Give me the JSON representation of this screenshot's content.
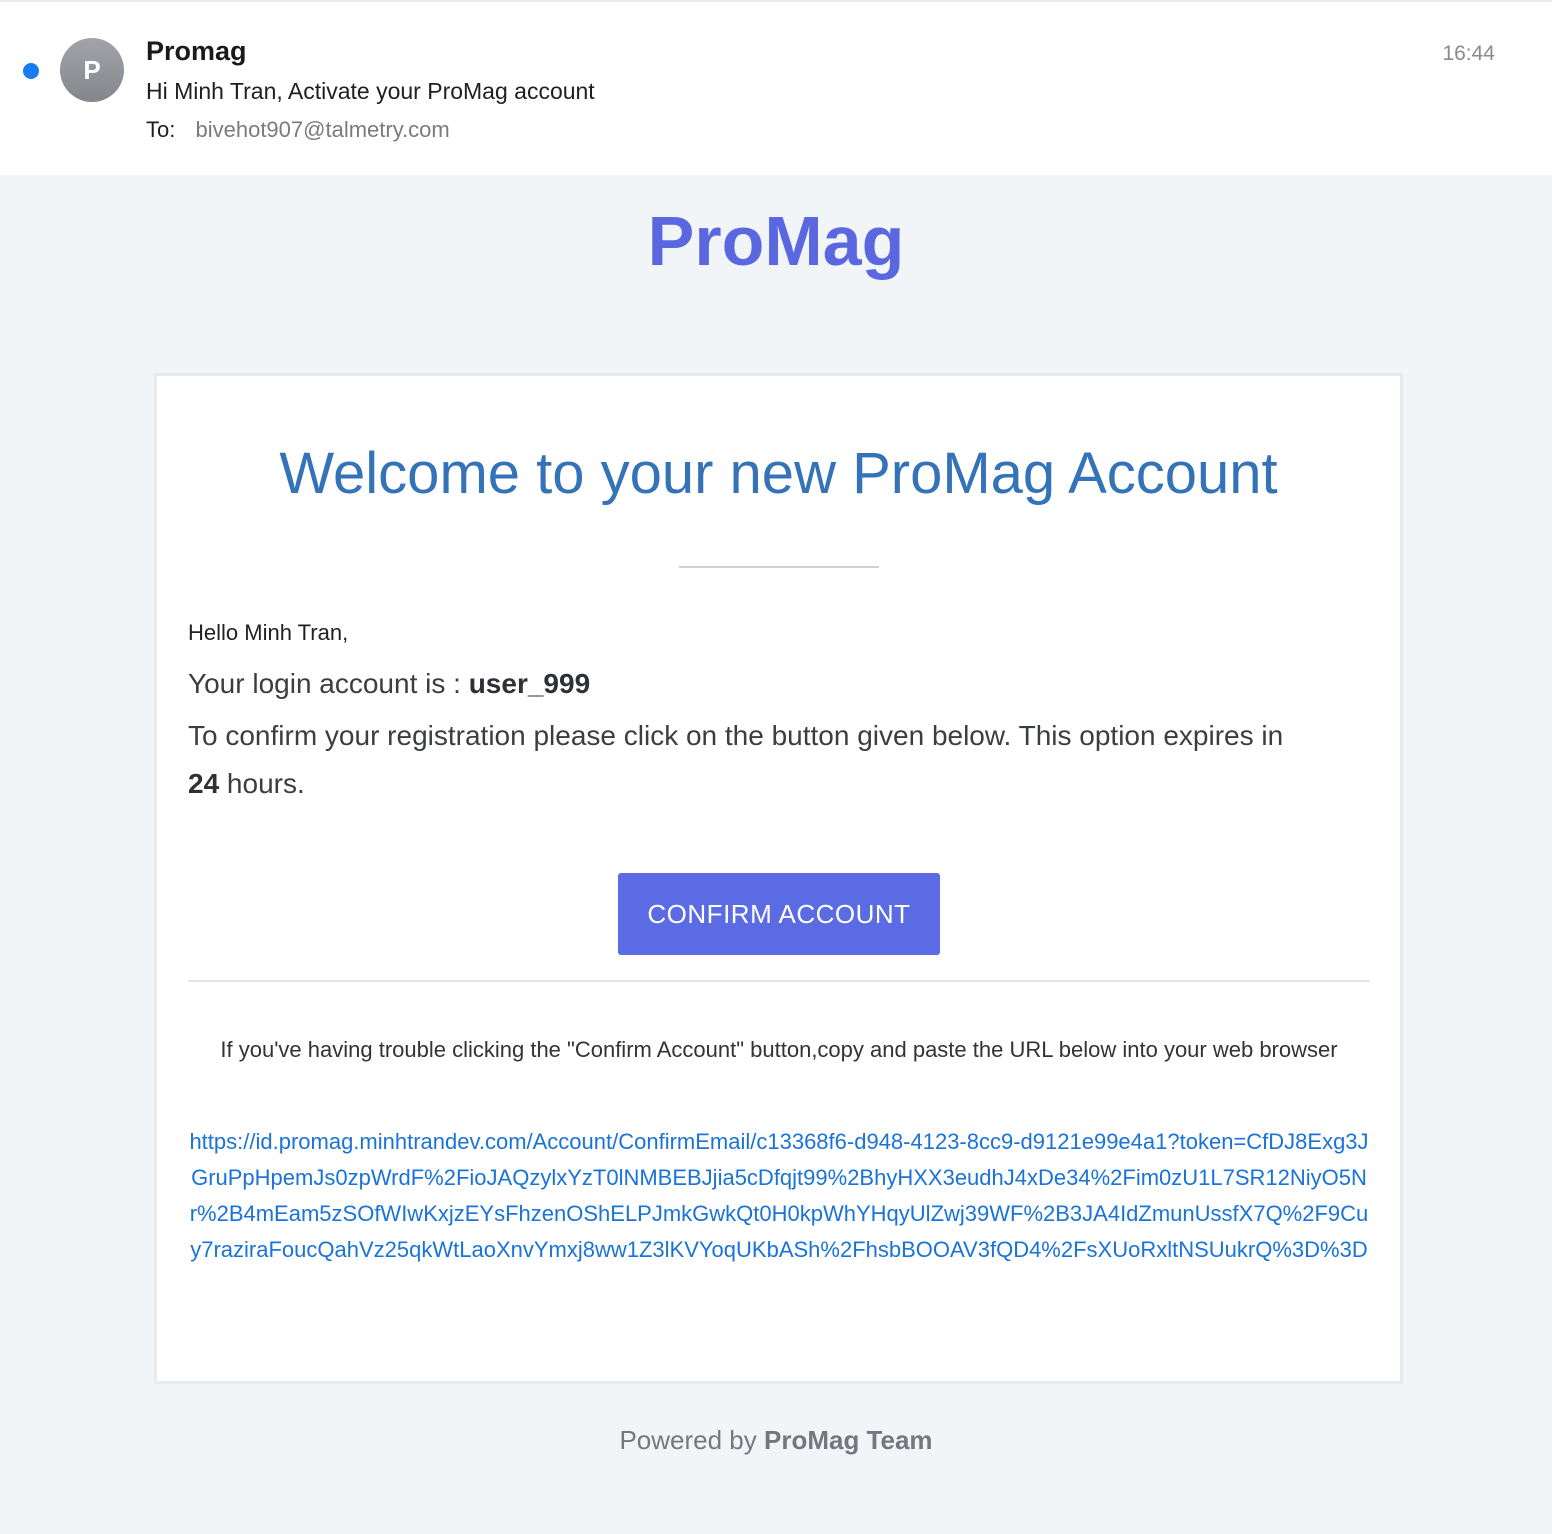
{
  "header": {
    "avatar_letter": "P",
    "sender": "Promag",
    "subject": "Hi Minh Tran, Activate your ProMag account",
    "to_label": "To:",
    "to_address": "bivehot907@talmetry.com",
    "time": "16:44"
  },
  "email": {
    "brand": "ProMag",
    "welcome_title": "Welcome to your new ProMag Account",
    "greeting": "Hello Minh Tran,",
    "login_prefix": "Your login account is : ",
    "login_account": "user_999",
    "confirm_text_before": "To confirm your registration please click on the button given below. This option expires in ",
    "expiry_hours": "24",
    "confirm_text_after": " hours.",
    "confirm_button_label": "CONFIRM ACCOUNT",
    "trouble_text": "If you've having trouble clicking the \"Confirm Account\" button,copy and paste the URL below into your web browser",
    "confirm_url": "https://id.promag.minhtrandev.com/Account/ConfirmEmail/c13368f6-d948-4123-8cc9-d9121e99e4a1?token=CfDJ8Exg3JGruPpHpemJs0zpWrdF%2FioJAQzylxYzT0lNMBEBJjia5cDfqjt99%2BhyHXX3eudhJ4xDe34%2Fim0zU1L7SR12NiyO5Nr%2B4mEam5zSOfWIwKxjzEYsFhzenOShELPJmkGwkQt0H0kpWhYHqyUlZwj39WF%2B3JA4IdZmunUssfX7Q%2F9Cuy7raziraFoucQahVz25qkWtLaoXnvYmxj8ww1Z3lKVYoqUKbASh%2FhsbBOOAV3fQD4%2FsXUoRxltNSUukrQ%3D%3D",
    "footer_prefix": "Powered by ",
    "footer_team": "ProMag Team"
  },
  "colors": {
    "brand": "#5a67e0",
    "welcome_title": "#3473b8",
    "button": "#5a6be4",
    "link": "#1a73d8",
    "unread_dot": "#1a7cf5"
  }
}
